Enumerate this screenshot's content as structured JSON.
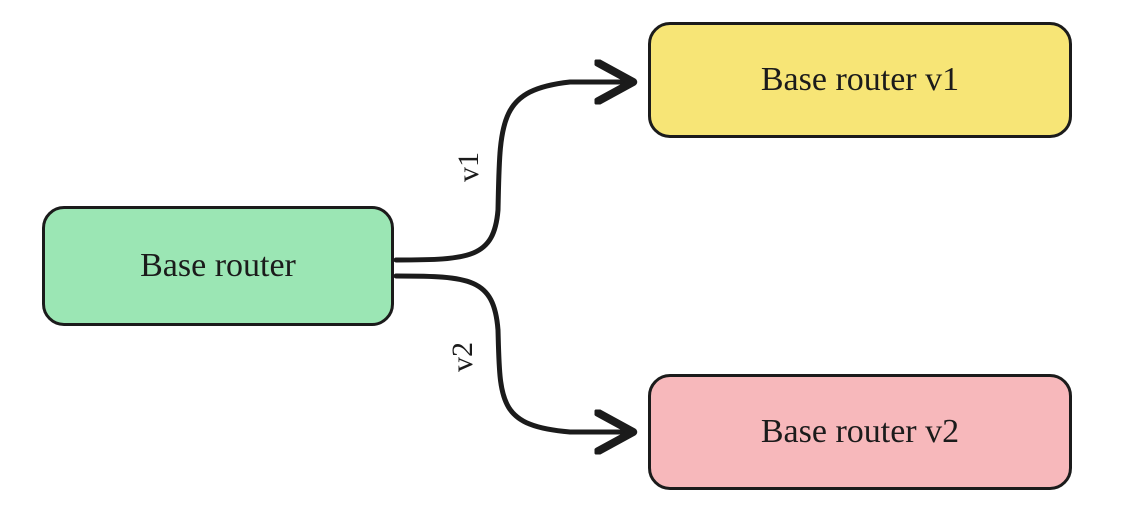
{
  "nodes": {
    "root": {
      "label": "Base router"
    },
    "v1": {
      "label": "Base router v1"
    },
    "v2": {
      "label": "Base router v2"
    }
  },
  "edges": {
    "to_v1": {
      "label": "v1"
    },
    "to_v2": {
      "label": "v2"
    }
  }
}
